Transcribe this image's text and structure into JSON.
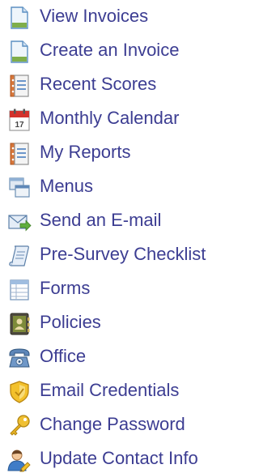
{
  "menu": {
    "items": [
      {
        "label": "View Invoices",
        "icon": "document-icon"
      },
      {
        "label": "Create an Invoice",
        "icon": "document-icon"
      },
      {
        "label": "Recent Scores",
        "icon": "notebook-icon"
      },
      {
        "label": "Monthly Calendar",
        "icon": "calendar-icon"
      },
      {
        "label": "My Reports",
        "icon": "notebook-icon"
      },
      {
        "label": "Menus",
        "icon": "windows-icon"
      },
      {
        "label": "Send an E-mail",
        "icon": "email-send-icon"
      },
      {
        "label": "Pre-Survey Checklist",
        "icon": "scroll-icon"
      },
      {
        "label": "Forms",
        "icon": "form-table-icon"
      },
      {
        "label": "Policies",
        "icon": "address-book-icon"
      },
      {
        "label": "Office",
        "icon": "telephone-icon"
      },
      {
        "label": "Email Credentials",
        "icon": "shield-icon"
      },
      {
        "label": "Change Password",
        "icon": "key-icon"
      },
      {
        "label": "Update Contact Info",
        "icon": "user-edit-icon"
      }
    ],
    "calendar_icon_day": "17"
  },
  "colors": {
    "link_text": "#3c3d92",
    "background": "#ffffff"
  }
}
